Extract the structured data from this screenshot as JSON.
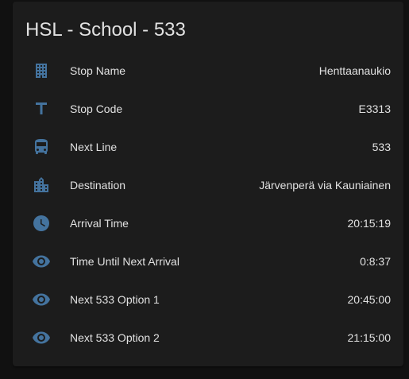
{
  "card": {
    "title": "HSL - School - 533"
  },
  "colors": {
    "icon": "#44739e",
    "text": "#e1e1e1",
    "card_background": "#1c1c1c",
    "page_background": "#111111"
  },
  "rows": [
    {
      "icon": "office-building-icon",
      "label": "Stop Name",
      "value": "Henttaanaukio"
    },
    {
      "icon": "format-title-icon",
      "label": "Stop Code",
      "value": "E3313"
    },
    {
      "icon": "bus-icon",
      "label": "Next Line",
      "value": "533"
    },
    {
      "icon": "city-icon",
      "label": "Destination",
      "value": "Järvenperä via Kauniainen"
    },
    {
      "icon": "clock-icon",
      "label": "Arrival Time",
      "value": "20:15:19"
    },
    {
      "icon": "eye-icon",
      "label": "Time Until Next Arrival",
      "value": "0:8:37"
    },
    {
      "icon": "eye-icon",
      "label": "Next 533 Option 1",
      "value": "20:45:00"
    },
    {
      "icon": "eye-icon",
      "label": "Next 533 Option 2",
      "value": "21:15:00"
    }
  ]
}
